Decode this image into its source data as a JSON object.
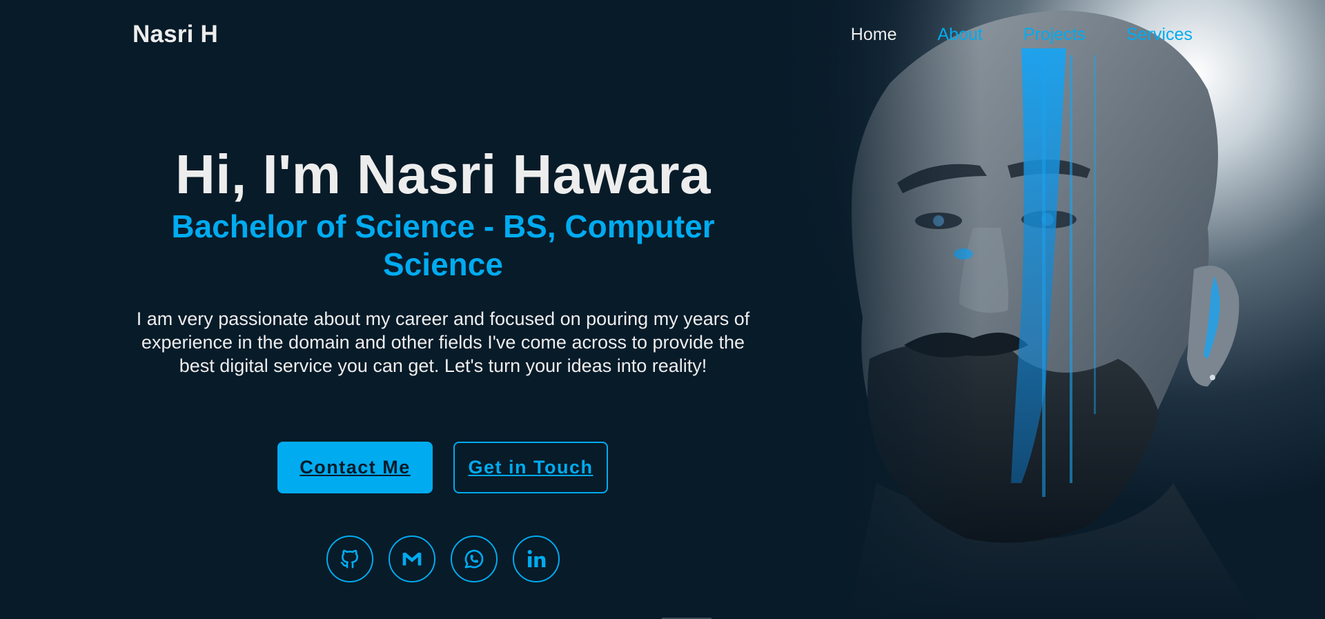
{
  "header": {
    "logo": "Nasri H",
    "nav": [
      {
        "label": "Home",
        "active": true
      },
      {
        "label": "About",
        "active": false
      },
      {
        "label": "Projects",
        "active": false
      },
      {
        "label": "Services",
        "active": false
      }
    ]
  },
  "hero": {
    "title": "Hi, I'm Nasri Hawara",
    "subtitle": "Bachelor of Science - BS, Computer Science",
    "description": "I am very passionate about my career and focused on pouring my years of experience in the domain and other fields I've come across to provide the best digital service you can get. Let's turn your ideas into reality!",
    "buttons": {
      "contact": "Contact Me",
      "touch": "Get in Touch"
    },
    "socials": [
      "github-icon",
      "gmail-icon",
      "whatsapp-icon",
      "linkedin-icon"
    ]
  },
  "colors": {
    "background": "#081b29",
    "accent": "#00abf0",
    "text": "#ededed"
  }
}
